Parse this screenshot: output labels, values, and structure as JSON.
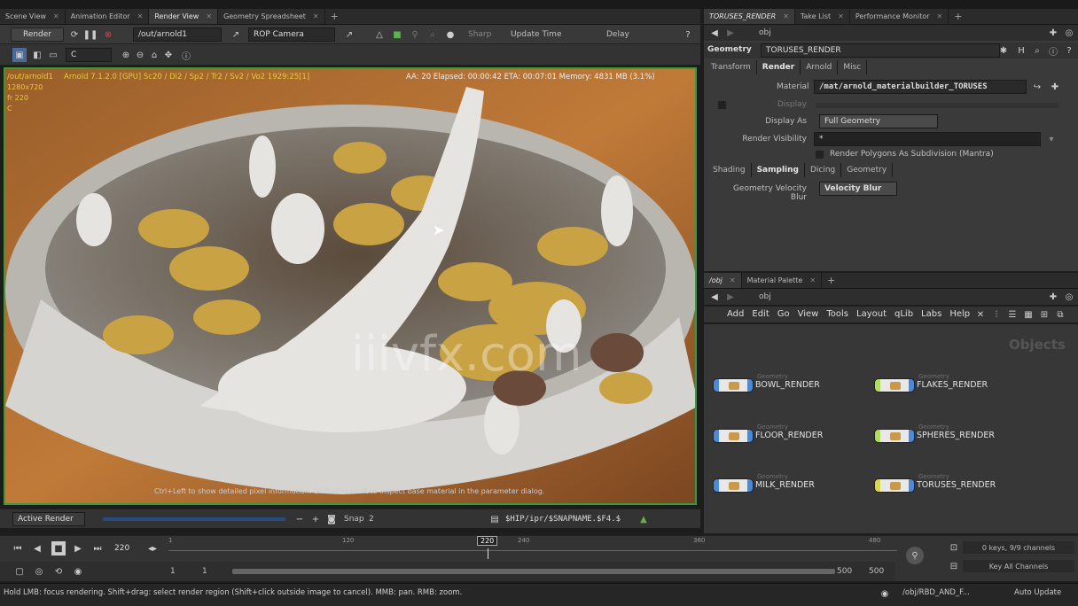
{
  "left_tabs": [
    "Scene View",
    "Animation Editor",
    "Render View",
    "Geometry Spreadsheet"
  ],
  "right_tabs": [
    "TORUSES_RENDER",
    "Take List",
    "Performance Monitor"
  ],
  "render_toolbar": {
    "render_label": "Render",
    "rop_path": "/out/arnold1",
    "camera": "ROP Camera",
    "sharp_label": "Sharp",
    "update_time_label": "Update Time",
    "delay_label": "Delay",
    "channel": "C"
  },
  "viewport": {
    "hud_path": "/out/arnold1",
    "hud_info": "Arnold 7.1.2.0 [GPU] Sc20 / Di2 / Sp2 / Tr2 / Sv2 / Vo2 1929:25[1]",
    "hud_line2": "1280x720",
    "hud_line3": "fr 220",
    "hud_line4": "C",
    "stats": "AA: 20   Elapsed: 00:00:42   ETA: 00:07:01   Memory: 4831 MB   (3.1%)",
    "hint": "Ctrl+Left to show detailed pixel information. Shift+Ctrl+Left to inspect base material in the parameter dialog.",
    "watermark": "iiivfx.com"
  },
  "render_bottom": {
    "active_render": "Active Render",
    "snap_label": "Snap",
    "snap_value": "2",
    "snap_path": "$HIP/ipr/$SNAPNAME.$F4.$"
  },
  "param_panel": {
    "network_path": "obj",
    "node_type": "Geometry",
    "node_name": "TORUSES_RENDER",
    "tabs": [
      "Transform",
      "Render",
      "Arnold",
      "Misc"
    ],
    "material_label": "Material",
    "material_value": "/mat/arnold_materialbuilder_TORUSES",
    "display_label": "Display",
    "display_as_label": "Display As",
    "display_as_value": "Full Geometry",
    "render_visibility_label": "Render Visibility",
    "render_visibility_value": "*",
    "render_polygons_label": "Render Polygons As Subdivision (Mantra)",
    "subtabs": [
      "Shading",
      "Sampling",
      "Dicing",
      "Geometry"
    ],
    "velocity_label": "Geometry Velocity Blur",
    "velocity_value": "Velocity Blur"
  },
  "network_panel": {
    "tabs": [
      "/obj",
      "Material Palette"
    ],
    "path": "obj",
    "menu": [
      "Add",
      "Edit",
      "Go",
      "View",
      "Tools",
      "Layout",
      "qLib",
      "Labs",
      "Help"
    ],
    "context_label": "Objects",
    "nodes": [
      {
        "type": "Geometry",
        "name": "BOWL_RENDER"
      },
      {
        "type": "Geometry",
        "name": "FLAKES_RENDER"
      },
      {
        "type": "Geometry",
        "name": "FLOOR_RENDER"
      },
      {
        "type": "Geometry",
        "name": "SPHERES_RENDER"
      },
      {
        "type": "Geometry",
        "name": "MILK_RENDER"
      },
      {
        "type": "Geometry",
        "name": "TORUSES_RENDER"
      }
    ]
  },
  "timeline": {
    "frame": "220",
    "marker": "220",
    "ticks": [
      "1",
      "120",
      "240",
      "360",
      "480"
    ],
    "start_a": "1",
    "start_b": "1",
    "end_a": "500",
    "end_b": "500",
    "keys_info": "0 keys, 9/9 channels",
    "key_all": "Key All Channels"
  },
  "status": {
    "message": "Hold LMB: focus rendering. Shift+drag: select render region (Shift+click outside image to cancel). MMB: pan. RMB: zoom.",
    "path": "/obj/RBD_AND_F...",
    "auto_update": "Auto Update"
  },
  "colors": {
    "accent": "#e8c840",
    "green_border": "#3a9a3a"
  }
}
